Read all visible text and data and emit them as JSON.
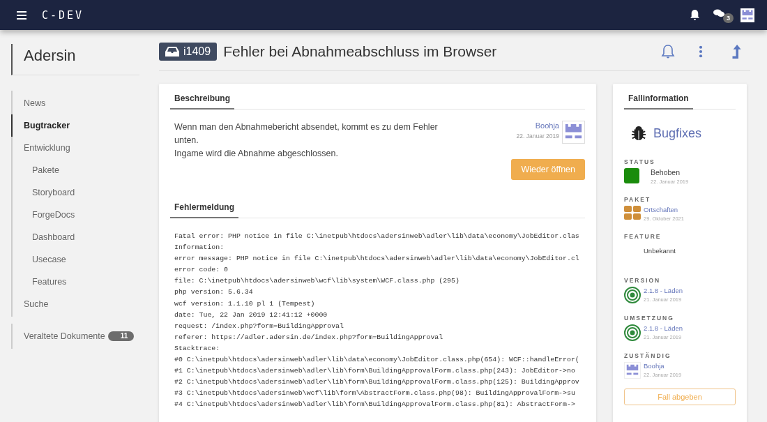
{
  "topbar": {
    "logo": "C-DEV",
    "chat_count": "3"
  },
  "sidebar": {
    "title": "Adersin",
    "items": [
      {
        "label": "News",
        "selected": false
      },
      {
        "label": "Bugtracker",
        "selected": true
      },
      {
        "label": "Entwicklung",
        "selected": false,
        "children": [
          {
            "label": "Pakete",
            "selected": false
          },
          {
            "label": "Storyboard",
            "selected": false
          },
          {
            "label": "ForgeDocs",
            "selected": false
          },
          {
            "label": "Dashboard",
            "selected": false
          },
          {
            "label": "Usecase",
            "selected": false
          },
          {
            "label": "Features",
            "selected": false
          }
        ]
      },
      {
        "label": "Suche",
        "selected": false
      }
    ],
    "extra": {
      "label": "Veraltete Dokumente",
      "count": "11"
    }
  },
  "issue": {
    "id": "i1409",
    "title": "Fehler bei Abnahmeabschluss im Browser"
  },
  "description": {
    "heading": "Beschreibung",
    "lines": [
      "Wenn man den Abnahmebericht absendet, kommt es zu dem Fehler unten.",
      "Ingame wird die Abnahme abgeschlossen."
    ],
    "author": "Boohja",
    "date": "22. Januar 2019",
    "button": "Wieder öffnen"
  },
  "error": {
    "heading": "Fehlermeldung",
    "lines": [
      "Fatal error: PHP notice in file C:\\inetpub\\htdocs\\adersinweb\\adler\\lib\\data\\economy\\JobEditor.clas",
      "Information:",
      "error message: PHP notice in file C:\\inetpub\\htdocs\\adersinweb\\adler\\lib\\data\\economy\\JobEditor.cl",
      "error code: 0",
      "file: C:\\inetpub\\htdocs\\adersinweb\\wcf\\lib\\system\\WCF.class.php (295)",
      "php version: 5.6.34",
      "wcf version: 1.1.10 pl 1 (Tempest)",
      "date: Tue, 22 Jan 2019 12:41:12 +0000",
      "request: /index.php?form=BuildingApproval",
      "referer: https://adler.adersin.de/index.php?form=BuildingApproval",
      "Stacktrace:",
      "#0 C:\\inetpub\\htdocs\\adersinweb\\adler\\lib\\data\\economy\\JobEditor.class.php(654): WCF::handleError(",
      "#1 C:\\inetpub\\htdocs\\adersinweb\\adler\\lib\\form\\BuildingApprovalForm.class.php(243): JobEditor->no",
      "#2 C:\\inetpub\\htdocs\\adersinweb\\adler\\lib\\form\\BuildingApprovalForm.class.php(125): BuildingApprov",
      "#3 C:\\inetpub\\htdocs\\adersinweb\\wcf\\lib\\form\\AbstractForm.class.php(98): BuildingApprovalForm->su",
      "#4 C:\\inetpub\\htdocs\\adersinweb\\adler\\lib\\form\\BuildingApprovalForm.class.php(81): AbstractForm->"
    ]
  },
  "info": {
    "heading": "Fallinformation",
    "category": "Bugfixes",
    "fields": [
      {
        "kind": "status",
        "label": "STATUS",
        "value": "Behoben",
        "date": "22. Januar 2019",
        "color": "#1a8c0c"
      },
      {
        "kind": "package",
        "label": "PAKET",
        "value": "Ortschaften",
        "date": "29. Oktober 2021"
      },
      {
        "kind": "plain",
        "label": "FEATURE",
        "value": "Unbekannt"
      },
      {
        "kind": "version",
        "label": "VERSION",
        "value": "2.1.8 - Läden",
        "date": "21. Januar 2019"
      },
      {
        "kind": "version",
        "label": "UMSETZUNG",
        "value": "2.1.8 - Läden",
        "date": "21. Januar 2019"
      },
      {
        "kind": "user",
        "label": "ZUSTÄNDIG",
        "value": "Boohja",
        "date": "22. Januar 2019"
      }
    ],
    "button": "Fall abgeben"
  }
}
